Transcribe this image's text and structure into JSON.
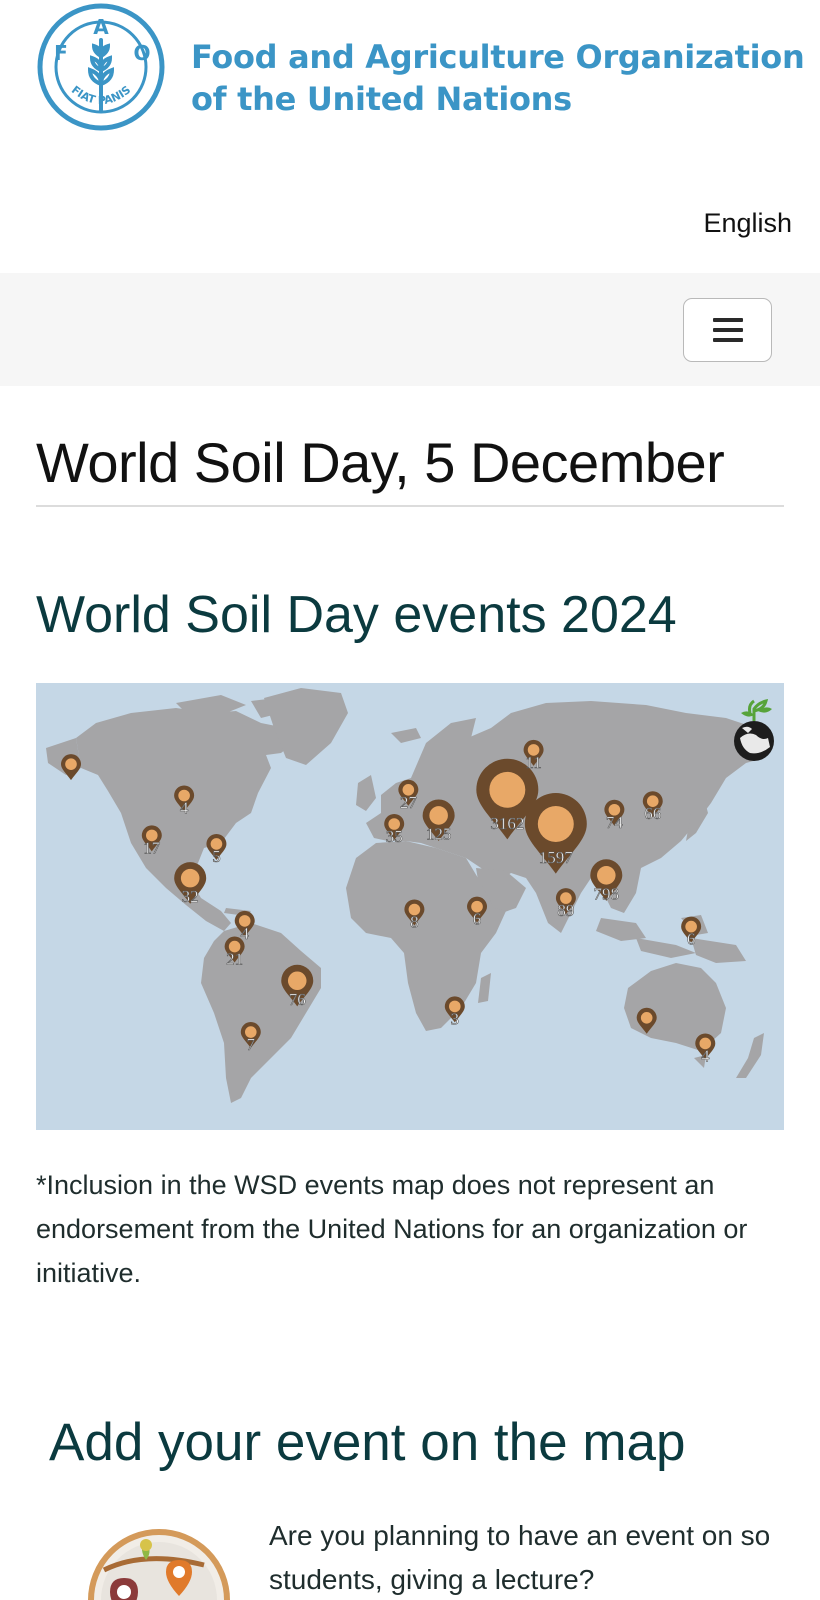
{
  "header": {
    "org_line1": "Food and Agriculture Organization",
    "org_line2": "of the United Nations",
    "logo": {
      "letters": [
        "F",
        "A",
        "O"
      ],
      "motto": "FIAT PANIS",
      "color": "#3b95c6"
    },
    "language": "English",
    "menu_icon": "hamburger-menu-icon"
  },
  "page": {
    "title": "World Soil Day, 5 December",
    "section_title": "World Soil Day events 2024"
  },
  "map": {
    "colors": {
      "ocean": "#c5d7e6",
      "land": "#a5a5a7",
      "pin": "#6b4a2c",
      "pin_core": "#e8a867",
      "label": "#ffffff"
    },
    "corner_icon": "soil-globe-sprout-icon",
    "markers": [
      {
        "label": "",
        "lon": -160,
        "lat": 61,
        "size": "small"
      },
      {
        "label": "4",
        "lon": -104,
        "lat": 50,
        "size": "small"
      },
      {
        "label": "17",
        "lon": -120,
        "lat": 36,
        "size": "small"
      },
      {
        "label": "5",
        "lon": -88,
        "lat": 33,
        "size": "small"
      },
      {
        "label": "32",
        "lon": -101,
        "lat": 21,
        "size": "medium"
      },
      {
        "label": "4",
        "lon": -74,
        "lat": 6,
        "size": "small"
      },
      {
        "label": "21",
        "lon": -79,
        "lat": -3,
        "size": "small"
      },
      {
        "label": "76",
        "lon": -48,
        "lat": -15,
        "size": "medium"
      },
      {
        "label": "7",
        "lon": -71,
        "lat": -33,
        "size": "small"
      },
      {
        "label": "27",
        "lon": 7,
        "lat": 52,
        "size": "small"
      },
      {
        "label": "35",
        "lon": 0,
        "lat": 40,
        "size": "small"
      },
      {
        "label": "125",
        "lon": 22,
        "lat": 43,
        "size": "medium"
      },
      {
        "label": "3162",
        "lon": 56,
        "lat": 52,
        "size": "large"
      },
      {
        "label": "11",
        "lon": 69,
        "lat": 66,
        "size": "small"
      },
      {
        "label": "1597",
        "lon": 80,
        "lat": 40,
        "size": "large"
      },
      {
        "label": "74",
        "lon": 109,
        "lat": 45,
        "size": "small"
      },
      {
        "label": "66",
        "lon": 128,
        "lat": 48,
        "size": "small"
      },
      {
        "label": "798",
        "lon": 105,
        "lat": 22,
        "size": "medium"
      },
      {
        "label": "89",
        "lon": 85,
        "lat": 14,
        "size": "small"
      },
      {
        "label": "8",
        "lon": 10,
        "lat": 10,
        "size": "small"
      },
      {
        "label": "6",
        "lon": 41,
        "lat": 11,
        "size": "small"
      },
      {
        "label": "3",
        "lon": 30,
        "lat": -24,
        "size": "small"
      },
      {
        "label": "6",
        "lon": 147,
        "lat": 4,
        "size": "small"
      },
      {
        "label": "",
        "lon": 125,
        "lat": -28,
        "size": "small"
      },
      {
        "label": "4",
        "lon": 154,
        "lat": -37,
        "size": "small"
      }
    ]
  },
  "disclaimer": "*Inclusion in the WSD events map does not represent an endorsement from the United Nations for an organization or initiative.",
  "add_event": {
    "title": "Add your event on the map",
    "text_line1": "Are you planning to have an event on so",
    "text_line2": "students, giving a lecture?",
    "icon": "map-pins-circle-icon"
  }
}
